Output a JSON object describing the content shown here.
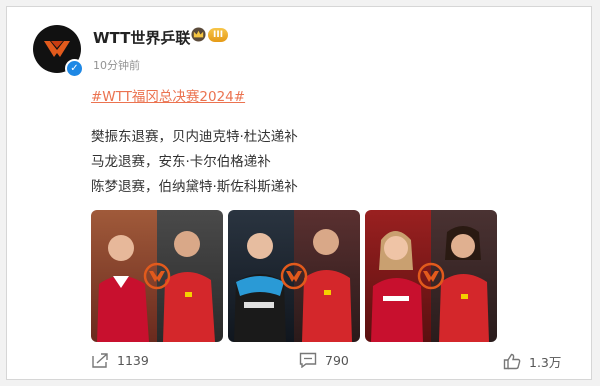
{
  "post": {
    "username": "WTT世界乒联",
    "level_badge": "III",
    "timestamp": "10分钟前",
    "hashtag": "#WTT福冈总决赛2024#",
    "lines": [
      "樊振东退赛，贝内迪克特·杜达递补",
      "马龙退赛，安东·卡尔伯格递补",
      "陈梦退赛，伯纳黛特·斯佐科斯递补"
    ]
  },
  "photos": [
    {
      "left_bg": "#7a3a2a",
      "right_bg": "#3a3a3a",
      "left_shirt": "#c8102e",
      "right_shirt": "#d4272b"
    },
    {
      "left_bg": "#1c2530",
      "right_bg": "#4a2a2a",
      "left_shirt": "#2a9ad6",
      "right_shirt": "#d4272b"
    },
    {
      "left_bg": "#8a1c1c",
      "right_bg": "#3e2a2a",
      "left_shirt": "#c8102e",
      "right_shirt": "#d4272b"
    }
  ],
  "footer": {
    "share_count": "1139",
    "comment_count": "790",
    "like_count": "1.3万"
  },
  "colors": {
    "accent": "#eb7350",
    "verified": "#1e88e5",
    "brand_logo": "#e25a1c"
  },
  "icons": [
    "verified-icon",
    "crown-icon",
    "share-icon",
    "comment-icon",
    "like-icon"
  ]
}
